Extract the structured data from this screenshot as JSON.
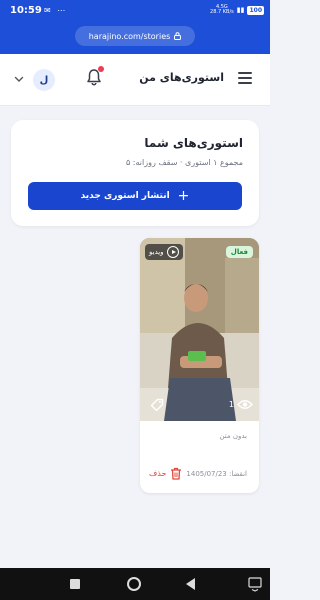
{
  "status_bar": {
    "time": "10:59",
    "net_speed": "28.7 KB/s",
    "net_prefix": "4.5G",
    "battery": "100"
  },
  "browser": {
    "url": "harajino.com/stories"
  },
  "header": {
    "title": "استوری‌های من",
    "avatar_letter": "ل",
    "notification_dot_color": "#ef3b55"
  },
  "summary": {
    "title": "استوری‌های شما",
    "subtitle": "مجموع ۱ استوری · سقف روزانه: ۵",
    "publish_button": "انتشار استوری جدید"
  },
  "story": {
    "status_badge": "فعال",
    "video_badge": "ویدیو",
    "views": "1",
    "caption": "بدون متن",
    "expiry": "انقضا: 1405/07/23",
    "delete_label": "حذف"
  },
  "colors": {
    "brand": "#1d4fd8",
    "button": "#1a46cf",
    "danger": "#e0463b",
    "active_bg": "#d9f6dd",
    "active_text": "#1c8a35"
  }
}
